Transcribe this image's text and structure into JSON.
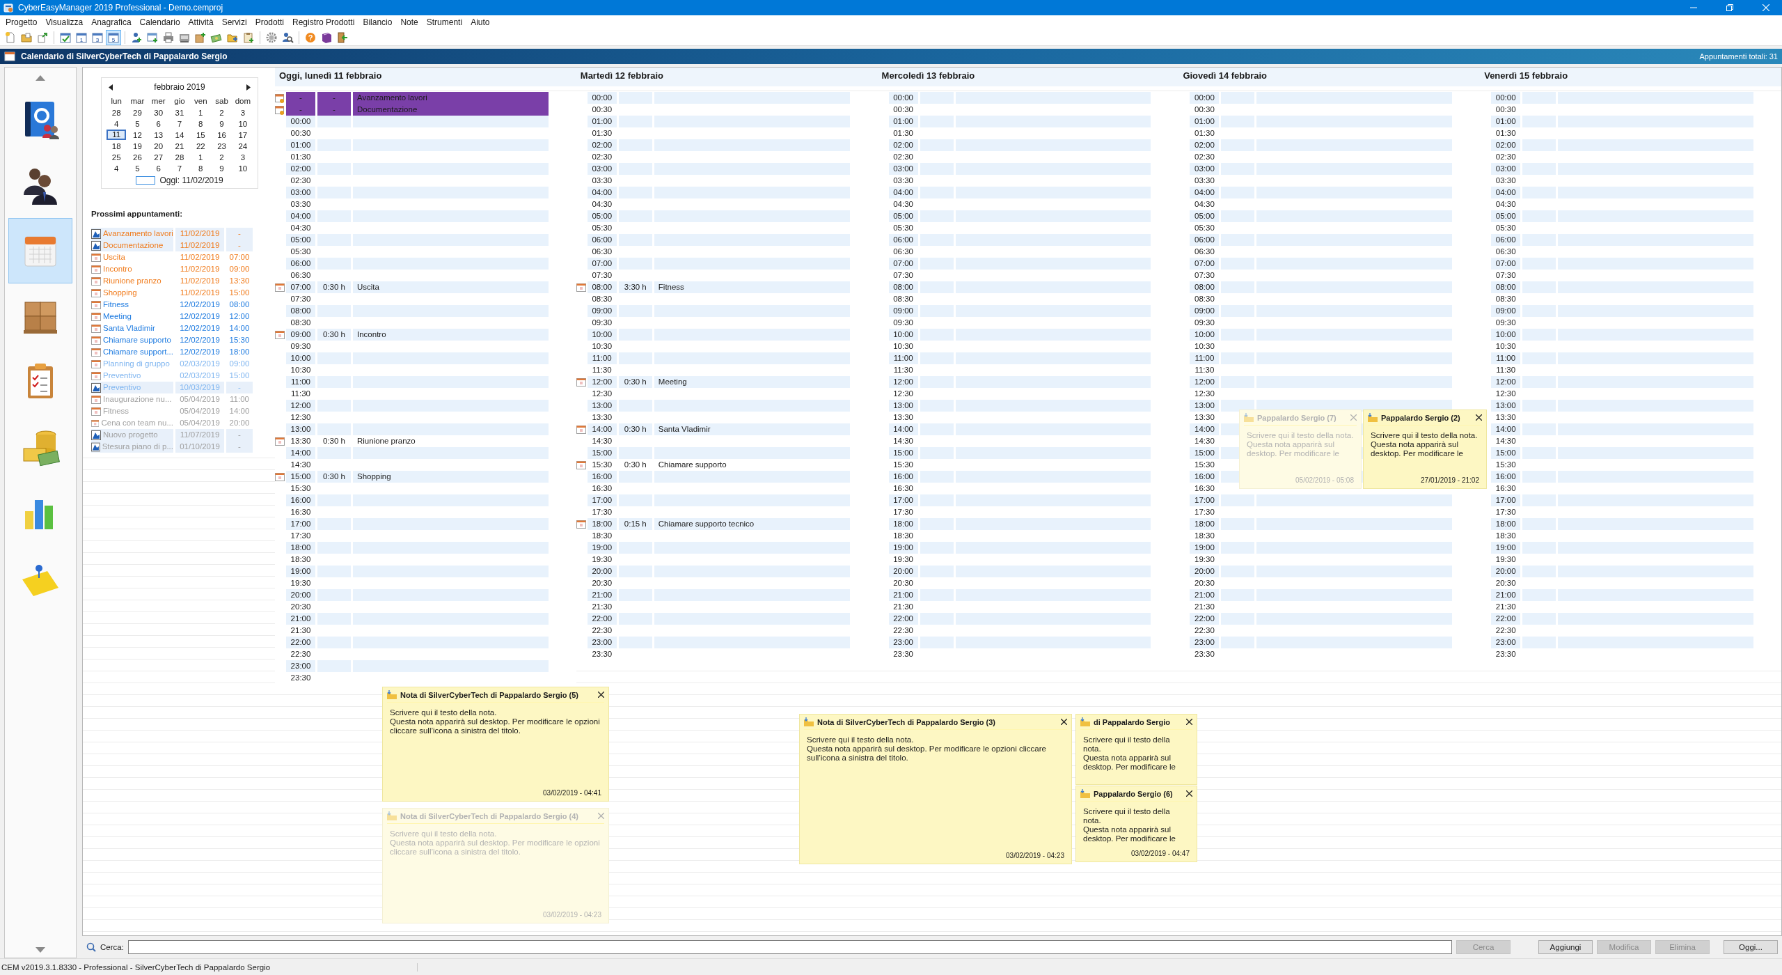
{
  "window": {
    "title": "CyberEasyManager 2019 Professional - Demo.cemproj"
  },
  "menu": [
    "Progetto",
    "Visualizza",
    "Anagrafica",
    "Calendario",
    "Attività",
    "Servizi",
    "Prodotti",
    "Registro Prodotti",
    "Bilancio",
    "Note",
    "Strumenti",
    "Aiuto"
  ],
  "toolbar": [
    {
      "kind": "new_page",
      "selected": false
    },
    {
      "kind": "open_folder",
      "selected": false
    },
    {
      "kind": "export",
      "selected": false
    },
    {
      "kind": "separator"
    },
    {
      "kind": "calendar_check",
      "selected": false
    },
    {
      "kind": "calendar_number",
      "label": "1",
      "selected": false
    },
    {
      "kind": "calendar_number",
      "label": "3",
      "selected": false
    },
    {
      "kind": "calendar_number",
      "label": "5",
      "selected": true
    },
    {
      "kind": "separator"
    },
    {
      "kind": "person_add",
      "selected": false
    },
    {
      "kind": "window_add",
      "selected": false
    },
    {
      "kind": "printer",
      "selected": false
    },
    {
      "kind": "scanner",
      "selected": false
    },
    {
      "kind": "box_add",
      "selected": false
    },
    {
      "kind": "money_add",
      "selected": false
    },
    {
      "kind": "folder_add",
      "selected": false
    },
    {
      "kind": "clipboard_add",
      "selected": false
    },
    {
      "kind": "separator"
    },
    {
      "kind": "gear",
      "selected": false
    },
    {
      "kind": "person_search",
      "selected": false
    },
    {
      "kind": "separator"
    },
    {
      "kind": "help",
      "label": "?",
      "selected": false
    },
    {
      "kind": "book",
      "selected": false
    },
    {
      "kind": "exit",
      "selected": false
    }
  ],
  "panel": {
    "title": "Calendario di SilverCyberTech di Pappalardo Sergio",
    "total": "Appuntamenti totali: 31"
  },
  "sidebar": {
    "items": [
      {
        "kind": "address_book",
        "selected": false
      },
      {
        "kind": "people",
        "selected": false
      },
      {
        "kind": "calendar",
        "selected": true
      },
      {
        "kind": "boxes",
        "selected": false
      },
      {
        "kind": "clipboard",
        "selected": false
      },
      {
        "kind": "coins",
        "selected": false
      },
      {
        "kind": "bar_chart",
        "selected": false
      },
      {
        "kind": "sticky_note",
        "selected": false
      }
    ]
  },
  "mini_calendar": {
    "month": "febbraio 2019",
    "weekdays": [
      "lun",
      "mar",
      "mer",
      "gio",
      "ven",
      "sab",
      "dom"
    ],
    "weeks": [
      [
        {
          "day": "28",
          "selected": false
        },
        {
          "day": "29",
          "selected": false
        },
        {
          "day": "30",
          "selected": false
        },
        {
          "day": "31",
          "selected": false
        },
        {
          "day": "1",
          "selected": false
        },
        {
          "day": "2",
          "selected": false
        },
        {
          "day": "3",
          "selected": false
        }
      ],
      [
        {
          "day": "4",
          "selected": false
        },
        {
          "day": "5",
          "selected": false
        },
        {
          "day": "6",
          "selected": false
        },
        {
          "day": "7",
          "selected": false
        },
        {
          "day": "8",
          "selected": false
        },
        {
          "day": "9",
          "selected": false
        },
        {
          "day": "10",
          "selected": false
        }
      ],
      [
        {
          "day": "11",
          "selected": true
        },
        {
          "day": "12",
          "selected": false
        },
        {
          "day": "13",
          "selected": false
        },
        {
          "day": "14",
          "selected": false
        },
        {
          "day": "15",
          "selected": false
        },
        {
          "day": "16",
          "selected": false
        },
        {
          "day": "17",
          "selected": false
        }
      ],
      [
        {
          "day": "18",
          "selected": false
        },
        {
          "day": "19",
          "selected": false
        },
        {
          "day": "20",
          "selected": false
        },
        {
          "day": "21",
          "selected": false
        },
        {
          "day": "22",
          "selected": false
        },
        {
          "day": "23",
          "selected": false
        },
        {
          "day": "24",
          "selected": false
        }
      ],
      [
        {
          "day": "25",
          "selected": false
        },
        {
          "day": "26",
          "selected": false
        },
        {
          "day": "27",
          "selected": false
        },
        {
          "day": "28",
          "selected": false
        },
        {
          "day": "1",
          "selected": false
        },
        {
          "day": "2",
          "selected": false
        },
        {
          "day": "3",
          "selected": false
        }
      ],
      [
        {
          "day": "4",
          "selected": false
        },
        {
          "day": "5",
          "selected": false
        },
        {
          "day": "6",
          "selected": false
        },
        {
          "day": "7",
          "selected": false
        },
        {
          "day": "8",
          "selected": false
        },
        {
          "day": "9",
          "selected": false
        },
        {
          "day": "10",
          "selected": false
        }
      ]
    ],
    "today": "Oggi: 11/02/2019"
  },
  "upcoming": {
    "title": "Prossimi appuntamenti:",
    "items": [
      {
        "kind": "all_day",
        "title": "Avanzamento lavori",
        "date": "11/02/2019",
        "time": "-",
        "color": "#f07a1a"
      },
      {
        "kind": "all_day",
        "title": "Documentazione",
        "date": "11/02/2019",
        "time": "-",
        "color": "#f07a1a"
      },
      {
        "kind": "timed",
        "title": "Uscita",
        "date": "11/02/2019",
        "time": "07:00",
        "color": "#f07a1a"
      },
      {
        "kind": "timed",
        "title": "Incontro",
        "date": "11/02/2019",
        "time": "09:00",
        "color": "#f07a1a"
      },
      {
        "kind": "timed",
        "title": "Riunione pranzo",
        "date": "11/02/2019",
        "time": "13:30",
        "color": "#f07a1a"
      },
      {
        "kind": "timed",
        "title": "Shopping",
        "date": "11/02/2019",
        "time": "15:00",
        "color": "#f07a1a"
      },
      {
        "kind": "timed",
        "title": "Fitness",
        "date": "12/02/2019",
        "time": "08:00",
        "color": "#1e7be0"
      },
      {
        "kind": "timed",
        "title": "Meeting",
        "date": "12/02/2019",
        "time": "12:00",
        "color": "#1e7be0"
      },
      {
        "kind": "timed",
        "title": "Santa Vladimir",
        "date": "12/02/2019",
        "time": "14:00",
        "color": "#1e7be0"
      },
      {
        "kind": "timed",
        "title": "Chiamare supporto",
        "date": "12/02/2019",
        "time": "15:30",
        "color": "#1e7be0"
      },
      {
        "kind": "timed",
        "title": "Chiamare support...",
        "date": "12/02/2019",
        "time": "18:00",
        "color": "#1e7be0"
      },
      {
        "kind": "timed",
        "title": "Planning di gruppo",
        "date": "02/03/2019",
        "time": "09:00",
        "color": "#80b6f0"
      },
      {
        "kind": "timed",
        "title": "Preventivo",
        "date": "02/03/2019",
        "time": "15:00",
        "color": "#80b6f0"
      },
      {
        "kind": "all_day",
        "title": "Preventivo",
        "date": "10/03/2019",
        "time": "-",
        "color": "#80b6f0"
      },
      {
        "kind": "timed",
        "title": "Inaugurazione nu...",
        "date": "05/04/2019",
        "time": "11:00",
        "color": "#a0a0a0"
      },
      {
        "kind": "timed",
        "title": "Fitness",
        "date": "05/04/2019",
        "time": "14:00",
        "color": "#a0a0a0"
      },
      {
        "kind": "timed",
        "title": "Cena con team nu...",
        "date": "05/04/2019",
        "time": "20:00",
        "color": "#a0a0a0"
      },
      {
        "kind": "all_day",
        "title": "Nuovo progetto",
        "date": "11/07/2019",
        "time": "-",
        "color": "#a0a0a0"
      },
      {
        "kind": "all_day",
        "title": "Stesura piano di p...",
        "date": "01/10/2019",
        "time": "-",
        "color": "#a0a0a0"
      }
    ]
  },
  "days": [
    {
      "title": "Oggi, lunedì 11 febbraio",
      "all_day": [
        {
          "start": "-",
          "duration": "-",
          "title": "Avanzamento lavori"
        },
        {
          "start": "-",
          "duration": "-",
          "title": "Documentazione"
        }
      ],
      "slots": [
        {
          "time": "00:00"
        },
        {
          "time": "00:30"
        },
        {
          "time": "01:00"
        },
        {
          "time": "01:30"
        },
        {
          "time": "02:00"
        },
        {
          "time": "02:30"
        },
        {
          "time": "03:00"
        },
        {
          "time": "03:30"
        },
        {
          "time": "04:00"
        },
        {
          "time": "04:30"
        },
        {
          "time": "05:00"
        },
        {
          "time": "05:30"
        },
        {
          "time": "06:00"
        },
        {
          "time": "06:30"
        },
        {
          "time": "07:00",
          "duration": "0:30 h",
          "title": "Uscita"
        },
        {
          "time": "07:30"
        },
        {
          "time": "08:00"
        },
        {
          "time": "08:30"
        },
        {
          "time": "09:00",
          "duration": "0:30 h",
          "title": "Incontro"
        },
        {
          "time": "09:30"
        },
        {
          "time": "10:00"
        },
        {
          "time": "10:30"
        },
        {
          "time": "11:00"
        },
        {
          "time": "11:30"
        },
        {
          "time": "12:00"
        },
        {
          "time": "12:30"
        },
        {
          "time": "13:00"
        },
        {
          "time": "13:30",
          "duration": "0:30 h",
          "title": "Riunione pranzo"
        },
        {
          "time": "14:00"
        },
        {
          "time": "14:30"
        },
        {
          "time": "15:00",
          "duration": "0:30 h",
          "title": "Shopping"
        },
        {
          "time": "15:30"
        },
        {
          "time": "16:00"
        },
        {
          "time": "16:30"
        },
        {
          "time": "17:00"
        },
        {
          "time": "17:30"
        },
        {
          "time": "18:00"
        },
        {
          "time": "18:30"
        },
        {
          "time": "19:00"
        },
        {
          "time": "19:30"
        },
        {
          "time": "20:00"
        },
        {
          "time": "20:30"
        },
        {
          "time": "21:00"
        },
        {
          "time": "21:30"
        },
        {
          "time": "22:00"
        },
        {
          "time": "22:30"
        },
        {
          "time": "23:00"
        },
        {
          "time": "23:30"
        }
      ]
    },
    {
      "title": "Martedì 12 febbraio",
      "slots": [
        {
          "time": "00:00"
        },
        {
          "time": "00:30"
        },
        {
          "time": "01:00"
        },
        {
          "time": "01:30"
        },
        {
          "time": "02:00"
        },
        {
          "time": "02:30"
        },
        {
          "time": "03:00"
        },
        {
          "time": "03:30"
        },
        {
          "time": "04:00"
        },
        {
          "time": "04:30"
        },
        {
          "time": "05:00"
        },
        {
          "time": "05:30"
        },
        {
          "time": "06:00"
        },
        {
          "time": "06:30"
        },
        {
          "time": "07:00"
        },
        {
          "time": "07:30"
        },
        {
          "time": "08:00",
          "duration": "3:30 h",
          "title": "Fitness"
        },
        {
          "time": "08:30"
        },
        {
          "time": "09:00"
        },
        {
          "time": "09:30"
        },
        {
          "time": "10:00"
        },
        {
          "time": "10:30"
        },
        {
          "time": "11:00"
        },
        {
          "time": "11:30"
        },
        {
          "time": "12:00",
          "duration": "0:30 h",
          "title": "Meeting"
        },
        {
          "time": "12:30"
        },
        {
          "time": "13:00"
        },
        {
          "time": "13:30"
        },
        {
          "time": "14:00",
          "duration": "0:30 h",
          "title": "Santa Vladimir"
        },
        {
          "time": "14:30"
        },
        {
          "time": "15:00"
        },
        {
          "time": "15:30",
          "duration": "0:30 h",
          "title": "Chiamare supporto"
        },
        {
          "time": "16:00"
        },
        {
          "time": "16:30"
        },
        {
          "time": "17:00"
        },
        {
          "time": "17:30"
        },
        {
          "time": "18:00",
          "duration": "0:15 h",
          "title": "Chiamare supporto tecnico"
        },
        {
          "time": "18:30"
        },
        {
          "time": "19:00"
        },
        {
          "time": "19:30"
        },
        {
          "time": "20:00"
        },
        {
          "time": "20:30"
        },
        {
          "time": "21:00"
        },
        {
          "time": "21:30"
        },
        {
          "time": "22:00"
        },
        {
          "time": "22:30"
        },
        {
          "time": "23:00"
        },
        {
          "time": "23:30"
        }
      ]
    },
    {
      "title": "Mercoledì 13 febbraio",
      "slots": [
        {
          "time": "00:00"
        },
        {
          "time": "00:30"
        },
        {
          "time": "01:00"
        },
        {
          "time": "01:30"
        },
        {
          "time": "02:00"
        },
        {
          "time": "02:30"
        },
        {
          "time": "03:00"
        },
        {
          "time": "03:30"
        },
        {
          "time": "04:00"
        },
        {
          "time": "04:30"
        },
        {
          "time": "05:00"
        },
        {
          "time": "05:30"
        },
        {
          "time": "06:00"
        },
        {
          "time": "06:30"
        },
        {
          "time": "07:00"
        },
        {
          "time": "07:30"
        },
        {
          "time": "08:00"
        },
        {
          "time": "08:30"
        },
        {
          "time": "09:00"
        },
        {
          "time": "09:30"
        },
        {
          "time": "10:00"
        },
        {
          "time": "10:30"
        },
        {
          "time": "11:00"
        },
        {
          "time": "11:30"
        },
        {
          "time": "12:00"
        },
        {
          "time": "12:30"
        },
        {
          "time": "13:00"
        },
        {
          "time": "13:30"
        },
        {
          "time": "14:00"
        },
        {
          "time": "14:30"
        },
        {
          "time": "15:00"
        },
        {
          "time": "15:30"
        },
        {
          "time": "16:00"
        },
        {
          "time": "16:30"
        },
        {
          "time": "17:00"
        },
        {
          "time": "17:30"
        },
        {
          "time": "18:00"
        },
        {
          "time": "18:30"
        },
        {
          "time": "19:00"
        },
        {
          "time": "19:30"
        },
        {
          "time": "20:00"
        },
        {
          "time": "20:30"
        },
        {
          "time": "21:00"
        },
        {
          "time": "21:30"
        },
        {
          "time": "22:00"
        },
        {
          "time": "22:30"
        },
        {
          "time": "23:00"
        },
        {
          "time": "23:30"
        }
      ]
    },
    {
      "title": "Giovedì 14 febbraio",
      "slots": [
        {
          "time": "00:00"
        },
        {
          "time": "00:30"
        },
        {
          "time": "01:00"
        },
        {
          "time": "01:30"
        },
        {
          "time": "02:00"
        },
        {
          "time": "02:30"
        },
        {
          "time": "03:00"
        },
        {
          "time": "03:30"
        },
        {
          "time": "04:00"
        },
        {
          "time": "04:30"
        },
        {
          "time": "05:00"
        },
        {
          "time": "05:30"
        },
        {
          "time": "06:00"
        },
        {
          "time": "06:30"
        },
        {
          "time": "07:00"
        },
        {
          "time": "07:30"
        },
        {
          "time": "08:00"
        },
        {
          "time": "08:30"
        },
        {
          "time": "09:00"
        },
        {
          "time": "09:30"
        },
        {
          "time": "10:00"
        },
        {
          "time": "10:30"
        },
        {
          "time": "11:00"
        },
        {
          "time": "11:30"
        },
        {
          "time": "12:00"
        },
        {
          "time": "12:30"
        },
        {
          "time": "13:00"
        },
        {
          "time": "13:30"
        },
        {
          "time": "14:00"
        },
        {
          "time": "14:30"
        },
        {
          "time": "15:00"
        },
        {
          "time": "15:30"
        },
        {
          "time": "16:00"
        },
        {
          "time": "16:30"
        },
        {
          "time": "17:00"
        },
        {
          "time": "17:30"
        },
        {
          "time": "18:00"
        },
        {
          "time": "18:30"
        },
        {
          "time": "19:00"
        },
        {
          "time": "19:30"
        },
        {
          "time": "20:00"
        },
        {
          "time": "20:30"
        },
        {
          "time": "21:00"
        },
        {
          "time": "21:30"
        },
        {
          "time": "22:00"
        },
        {
          "time": "22:30"
        },
        {
          "time": "23:00"
        },
        {
          "time": "23:30"
        }
      ]
    },
    {
      "title": "Venerdì 15 febbraio",
      "slots": [
        {
          "time": "00:00"
        },
        {
          "time": "00:30"
        },
        {
          "time": "01:00"
        },
        {
          "time": "01:30"
        },
        {
          "time": "02:00"
        },
        {
          "time": "02:30"
        },
        {
          "time": "03:00"
        },
        {
          "time": "03:30"
        },
        {
          "time": "04:00"
        },
        {
          "time": "04:30"
        },
        {
          "time": "05:00"
        },
        {
          "time": "05:30"
        },
        {
          "time": "06:00"
        },
        {
          "time": "06:30"
        },
        {
          "time": "07:00"
        },
        {
          "time": "07:30"
        },
        {
          "time": "08:00"
        },
        {
          "time": "08:30"
        },
        {
          "time": "09:00"
        },
        {
          "time": "09:30"
        },
        {
          "time": "10:00"
        },
        {
          "time": "10:30"
        },
        {
          "time": "11:00"
        },
        {
          "time": "11:30"
        },
        {
          "time": "12:00"
        },
        {
          "time": "12:30"
        },
        {
          "time": "13:00"
        },
        {
          "time": "13:30"
        },
        {
          "time": "14:00"
        },
        {
          "time": "14:30"
        },
        {
          "time": "15:00"
        },
        {
          "time": "15:30"
        },
        {
          "time": "16:00"
        },
        {
          "time": "16:30"
        },
        {
          "time": "17:00"
        },
        {
          "time": "17:30"
        },
        {
          "time": "18:00"
        },
        {
          "time": "18:30"
        },
        {
          "time": "19:00"
        },
        {
          "time": "19:30"
        },
        {
          "time": "20:00"
        },
        {
          "time": "20:30"
        },
        {
          "time": "21:00"
        },
        {
          "time": "21:30"
        },
        {
          "time": "22:00"
        },
        {
          "time": "22:30"
        },
        {
          "time": "23:00"
        },
        {
          "time": "23:30"
        }
      ]
    }
  ],
  "notes": [
    {
      "title": "Pappalardo Sergio (7)",
      "body": "Scrivere qui il testo della nota.\nQuesta nota apparirà sul desktop. Per modificare le",
      "date": "05/02/2019 - 05:08",
      "faded": true
    },
    {
      "title": "Pappalardo Sergio (2)",
      "body": "Scrivere qui il testo della nota.\nQuesta nota apparirà sul desktop. Per modificare le",
      "date": "27/01/2019 - 21:02",
      "faded": false
    },
    {
      "title": "Nota di SilverCyberTech di Pappalardo Sergio (5)",
      "body": "Scrivere qui il testo della nota.\nQuesta nota apparirà sul desktop. Per modificare le opzioni cliccare sull’icona a sinistra del titolo.",
      "date": "03/02/2019 - 04:41",
      "faded": false
    },
    {
      "title": "Nota di SilverCyberTech di Pappalardo Sergio (3)",
      "body": "Scrivere qui il testo della nota.\nQuesta nota apparirà sul desktop. Per modificare le opzioni cliccare sull’icona a sinistra del titolo.",
      "date": "03/02/2019 - 04:23",
      "faded": false
    },
    {
      "title": "di Pappalardo Sergio",
      "body": "Scrivere qui il testo della nota.\nQuesta nota apparirà sul desktop. Per modificare le",
      "faded": false
    },
    {
      "title": "Pappalardo Sergio (6)",
      "body": "Scrivere qui il testo della nota.\nQuesta nota apparirà sul desktop. Per modificare le",
      "date": "03/02/2019 - 04:47",
      "faded": false
    },
    {
      "title": "Nota di SilverCyberTech di Pappalardo Sergio (4)",
      "body": "Scrivere qui il testo della nota.\nQuesta nota apparirà sul desktop. Per modificare le opzioni cliccare sull’icona a sinistra del titolo.",
      "date": "03/02/2019 - 04:23",
      "faded": true
    }
  ],
  "search": {
    "label": "Cerca:",
    "buttons": [
      {
        "label": "Cerca",
        "disabled": true
      },
      {
        "label": "Aggiungi",
        "disabled": false
      },
      {
        "label": "Modifica",
        "disabled": true
      },
      {
        "label": "Elimina",
        "disabled": true
      },
      {
        "label": "Oggi...",
        "disabled": false
      }
    ]
  },
  "status_bar": {
    "text": "CEM v2019.3.1.8330 - Professional - SilverCyberTech di Pappalardo Sergio"
  }
}
